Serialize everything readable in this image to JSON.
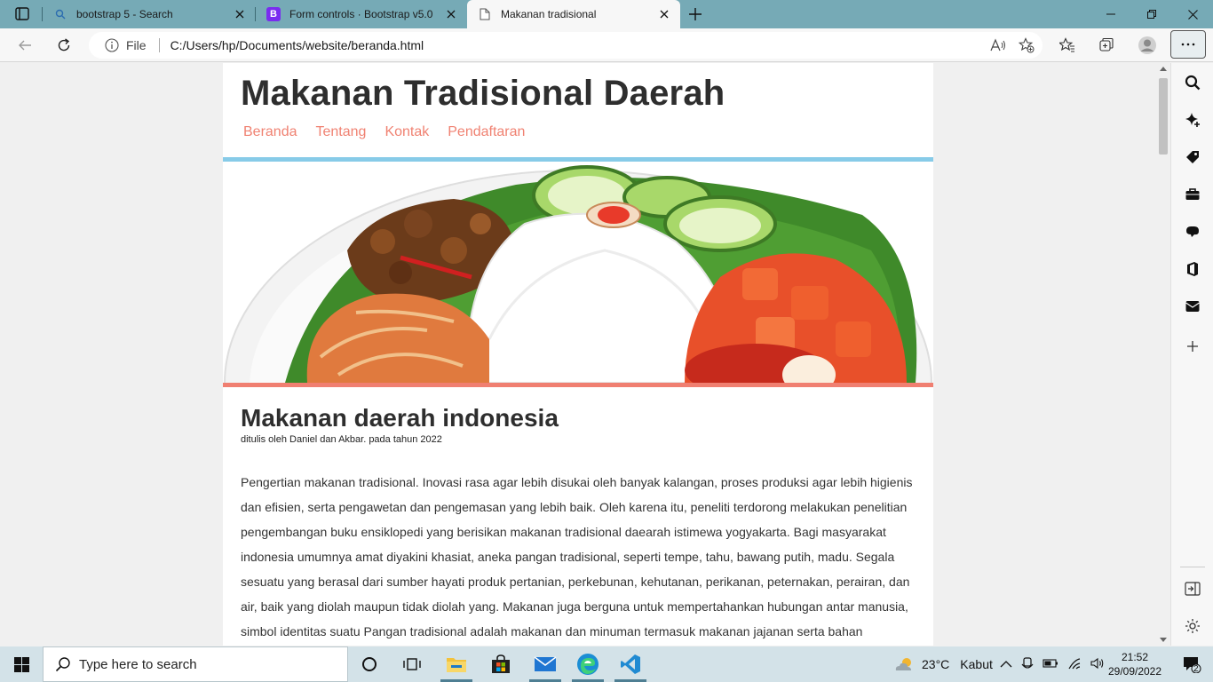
{
  "browser": {
    "tabs": [
      {
        "title": "bootstrap 5 - Search",
        "icon": "search-icon",
        "active": false
      },
      {
        "title": "Form controls · Bootstrap v5.0",
        "icon": "bootstrap-icon",
        "icon_letter": "B",
        "active": false
      },
      {
        "title": "Makanan tradisional",
        "icon": "page-icon",
        "active": true
      }
    ],
    "address": {
      "scheme_label": "File",
      "url": "C:/Users/hp/Documents/website/beranda.html"
    },
    "colors": {
      "tabstrip": "#76aab6",
      "toolbar": "#f7f7f7"
    }
  },
  "page": {
    "site_title": "Makanan Tradisional Daerah",
    "nav": [
      "Beranda",
      "Tentang",
      "Kontak",
      "Pendaftaran"
    ],
    "hero_image": "nasi-uduk-plate-image",
    "article": {
      "title": "Makanan daerah indonesia",
      "byline": "ditulis oleh Daniel dan Akbar. pada tahun 2022",
      "body": "Pengertian makanan tradisional. Inovasi rasa agar lebih disukai oleh banyak kalangan, proses produksi agar lebih higienis dan efisien, serta pengawetan dan pengemasan yang lebih baik. Oleh karena itu, peneliti terdorong melakukan penelitian pengembangan buku ensiklopedi yang berisikan makanan tradisional daearah istimewa yogyakarta. Bagi masyarakat indonesia umumnya amat diyakini khasiat, aneka pangan tradisional, seperti tempe, tahu, bawang putih, madu. Segala sesuatu yang berasal dari sumber hayati produk pertanian, perkebunan, kehutanan, perikanan, peternakan, perairan, dan air, baik yang diolah maupun tidak diolah yang. Makanan juga berguna untuk mempertahankan hubungan antar manusia, simbol identitas suatu Pangan tradisional adalah makanan dan minuman termasuk makanan jajanan serta bahan"
    },
    "colors": {
      "nav_link": "#f08272",
      "bar_blue": "#87cbe8",
      "bar_red": "#f07f71",
      "title": "#2e2e2e"
    }
  },
  "sidebar": [
    "search-icon",
    "sparkle-icon",
    "tag-icon",
    "briefcase-icon",
    "games-icon",
    "office-icon",
    "outlook-icon",
    "add-icon",
    "split-screen-icon",
    "settings-icon"
  ],
  "taskbar": {
    "search_placeholder": "Type here to search",
    "apps": [
      "cortana-icon",
      "task-view-icon",
      "file-explorer-icon",
      "store-icon",
      "mail-icon",
      "edge-icon",
      "vscode-icon"
    ],
    "weather": {
      "temp": "23°C",
      "condition": "Kabut"
    },
    "time": "21:52",
    "date": "29/09/2022",
    "notifications": "2"
  }
}
